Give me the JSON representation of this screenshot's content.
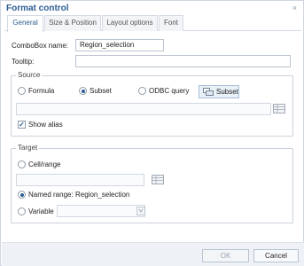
{
  "dialog": {
    "title": "Format control",
    "close_glyph": "×"
  },
  "tabs": [
    {
      "label": "General",
      "active": true
    },
    {
      "label": "Size & Position",
      "active": false
    },
    {
      "label": "Layout options",
      "active": false
    },
    {
      "label": "Font",
      "active": false
    }
  ],
  "general": {
    "combobox_name_label": "ComboBox name:",
    "combobox_name_value": "Region_selection",
    "tooltip_label": "Tooltip:",
    "tooltip_value": ""
  },
  "source": {
    "legend": "Source",
    "options": {
      "formula": "Formula",
      "subset": "Subset",
      "odbc": "ODBC query"
    },
    "selected": "subset",
    "subset_button_label": "Subset",
    "range_value": "",
    "show_alias_label": "Show alias",
    "show_alias_checked": true,
    "check_glyph": "✓"
  },
  "target": {
    "legend": "Target",
    "options": {
      "cell_range": "Cell/range",
      "named_range": "Named range:",
      "variable": "Variable"
    },
    "selected": "named_range",
    "cell_range_value": "",
    "named_range_value": "Region_selection",
    "variable_value": ""
  },
  "footer": {
    "ok_label": "OK",
    "cancel_label": "Cancel"
  },
  "icons": {
    "close": "close-icon",
    "range_picker": "range-picker-icon",
    "subset": "subset-icon",
    "variable_picker": "variable-picker-icon"
  },
  "colors": {
    "title": "#2b5d93",
    "accent": "#2b5d93",
    "footer_bg": "#eef1f5"
  }
}
